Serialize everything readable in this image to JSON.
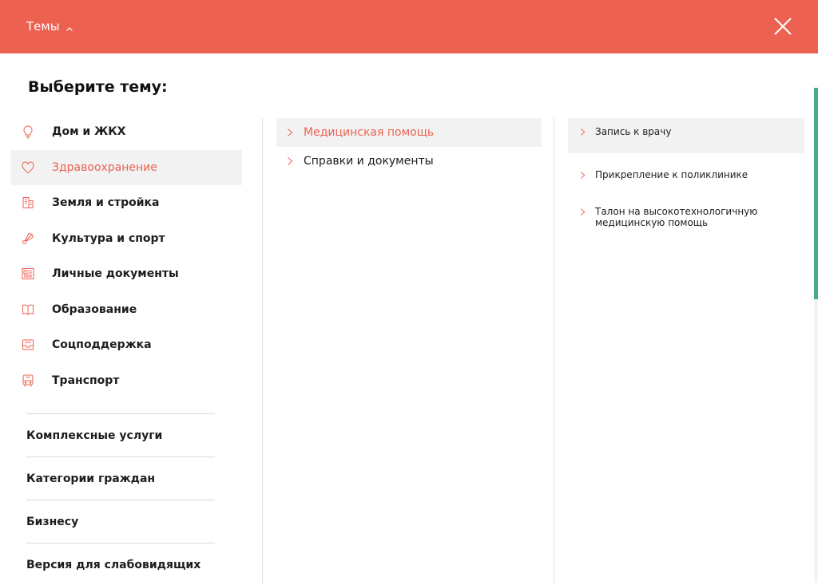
{
  "header": {
    "menu_label": "Темы",
    "accent": "#ec6150"
  },
  "heading": "Выберите тему:",
  "categories": [
    {
      "label": "Дом и ЖКХ",
      "icon": "lightbulb-icon"
    },
    {
      "label": "Здравоохранение",
      "icon": "heart-icon"
    },
    {
      "label": "Земля и стройка",
      "icon": "building-icon"
    },
    {
      "label": "Культура и спорт",
      "icon": "shuttlecock-icon"
    },
    {
      "label": "Личные документы",
      "icon": "document-icon"
    },
    {
      "label": "Образование",
      "icon": "book-icon"
    },
    {
      "label": "Соцподдержка",
      "icon": "inbox-icon"
    },
    {
      "label": "Транспорт",
      "icon": "bus-icon"
    }
  ],
  "active_category": "Здравоохранение",
  "extras": [
    {
      "label": "Комплексные услуги"
    },
    {
      "label": "Категории граждан"
    },
    {
      "label": "Бизнесу"
    },
    {
      "label": "Версия для слабовидящих"
    }
  ],
  "subcategories": [
    {
      "label": "Медицинская помощь"
    },
    {
      "label": "Справки и документы"
    }
  ],
  "services": [
    {
      "label": "Запись к врачу"
    },
    {
      "label": "Прикрепление к поликлинике"
    },
    {
      "label": "Талон на высокотехнологичную медицинскую помощь"
    }
  ]
}
